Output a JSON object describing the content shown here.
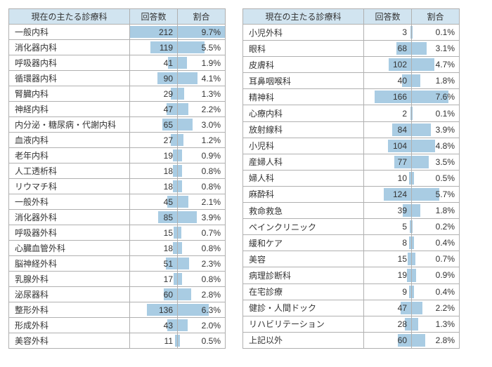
{
  "headers": {
    "dept": "現在の主たる診療科",
    "count": "回答数",
    "pct": "割合"
  },
  "rows_left": [
    {
      "dept": "一般内科",
      "count": 212,
      "pct": "9.7%"
    },
    {
      "dept": "消化器内科",
      "count": 119,
      "pct": "5.5%"
    },
    {
      "dept": "呼吸器内科",
      "count": 41,
      "pct": "1.9%"
    },
    {
      "dept": "循環器内科",
      "count": 90,
      "pct": "4.1%"
    },
    {
      "dept": "腎臓内科",
      "count": 29,
      "pct": "1.3%"
    },
    {
      "dept": "神経内科",
      "count": 47,
      "pct": "2.2%"
    },
    {
      "dept": "内分泌・糖尿病・代謝内科",
      "count": 65,
      "pct": "3.0%"
    },
    {
      "dept": "血液内科",
      "count": 27,
      "pct": "1.2%"
    },
    {
      "dept": "老年内科",
      "count": 19,
      "pct": "0.9%"
    },
    {
      "dept": "人工透析科",
      "count": 18,
      "pct": "0.8%"
    },
    {
      "dept": "リウマチ科",
      "count": 18,
      "pct": "0.8%"
    },
    {
      "dept": "一般外科",
      "count": 45,
      "pct": "2.1%"
    },
    {
      "dept": "消化器外科",
      "count": 85,
      "pct": "3.9%"
    },
    {
      "dept": "呼吸器外科",
      "count": 15,
      "pct": "0.7%"
    },
    {
      "dept": "心臓血管外科",
      "count": 18,
      "pct": "0.8%"
    },
    {
      "dept": "脳神経外科",
      "count": 51,
      "pct": "2.3%"
    },
    {
      "dept": "乳腺外科",
      "count": 17,
      "pct": "0.8%"
    },
    {
      "dept": "泌尿器科",
      "count": 60,
      "pct": "2.8%"
    },
    {
      "dept": "整形外科",
      "count": 136,
      "pct": "6.3%"
    },
    {
      "dept": "形成外科",
      "count": 43,
      "pct": "2.0%"
    },
    {
      "dept": "美容外科",
      "count": 11,
      "pct": "0.5%"
    }
  ],
  "rows_right": [
    {
      "dept": "小児外科",
      "count": 3,
      "pct": "0.1%"
    },
    {
      "dept": "眼科",
      "count": 68,
      "pct": "3.1%"
    },
    {
      "dept": "皮膚科",
      "count": 102,
      "pct": "4.7%"
    },
    {
      "dept": "耳鼻咽喉科",
      "count": 40,
      "pct": "1.8%"
    },
    {
      "dept": "精神科",
      "count": 166,
      "pct": "7.6%"
    },
    {
      "dept": "心療内科",
      "count": 2,
      "pct": "0.1%"
    },
    {
      "dept": "放射線科",
      "count": 84,
      "pct": "3.9%"
    },
    {
      "dept": "小児科",
      "count": 104,
      "pct": "4.8%"
    },
    {
      "dept": "産婦人科",
      "count": 77,
      "pct": "3.5%"
    },
    {
      "dept": "婦人科",
      "count": 10,
      "pct": "0.5%"
    },
    {
      "dept": "麻酔科",
      "count": 124,
      "pct": "5.7%"
    },
    {
      "dept": "救命救急",
      "count": 39,
      "pct": "1.8%"
    },
    {
      "dept": "ペインクリニック",
      "count": 5,
      "pct": "0.2%"
    },
    {
      "dept": "緩和ケア",
      "count": 8,
      "pct": "0.4%"
    },
    {
      "dept": "美容",
      "count": 15,
      "pct": "0.7%"
    },
    {
      "dept": "病理診断科",
      "count": 19,
      "pct": "0.9%"
    },
    {
      "dept": "在宅診療",
      "count": 9,
      "pct": "0.4%"
    },
    {
      "dept": "健診・人間ドック",
      "count": 47,
      "pct": "2.2%"
    },
    {
      "dept": "リハビリテーション",
      "count": 28,
      "pct": "1.3%"
    },
    {
      "dept": "上記以外",
      "count": 60,
      "pct": "2.8%"
    }
  ],
  "chart_data": {
    "type": "table",
    "title": "現在の主たる診療科",
    "columns": [
      "診療科",
      "回答数",
      "割合"
    ],
    "max_count": 212,
    "max_pct": 9.7,
    "rows": [
      [
        "一般内科",
        212,
        9.7
      ],
      [
        "消化器内科",
        119,
        5.5
      ],
      [
        "呼吸器内科",
        41,
        1.9
      ],
      [
        "循環器内科",
        90,
        4.1
      ],
      [
        "腎臓内科",
        29,
        1.3
      ],
      [
        "神経内科",
        47,
        2.2
      ],
      [
        "内分泌・糖尿病・代謝内科",
        65,
        3.0
      ],
      [
        "血液内科",
        27,
        1.2
      ],
      [
        "老年内科",
        19,
        0.9
      ],
      [
        "人工透析科",
        18,
        0.8
      ],
      [
        "リウマチ科",
        18,
        0.8
      ],
      [
        "一般外科",
        45,
        2.1
      ],
      [
        "消化器外科",
        85,
        3.9
      ],
      [
        "呼吸器外科",
        15,
        0.7
      ],
      [
        "心臓血管外科",
        18,
        0.8
      ],
      [
        "脳神経外科",
        51,
        2.3
      ],
      [
        "乳腺外科",
        17,
        0.8
      ],
      [
        "泌尿器科",
        60,
        2.8
      ],
      [
        "整形外科",
        136,
        6.3
      ],
      [
        "形成外科",
        43,
        2.0
      ],
      [
        "美容外科",
        11,
        0.5
      ],
      [
        "小児外科",
        3,
        0.1
      ],
      [
        "眼科",
        68,
        3.1
      ],
      [
        "皮膚科",
        102,
        4.7
      ],
      [
        "耳鼻咽喉科",
        40,
        1.8
      ],
      [
        "精神科",
        166,
        7.6
      ],
      [
        "心療内科",
        2,
        0.1
      ],
      [
        "放射線科",
        84,
        3.9
      ],
      [
        "小児科",
        104,
        4.8
      ],
      [
        "産婦人科",
        77,
        3.5
      ],
      [
        "婦人科",
        10,
        0.5
      ],
      [
        "麻酔科",
        124,
        5.7
      ],
      [
        "救命救急",
        39,
        1.8
      ],
      [
        "ペインクリニック",
        5,
        0.2
      ],
      [
        "緩和ケア",
        8,
        0.4
      ],
      [
        "美容",
        15,
        0.7
      ],
      [
        "病理診断科",
        19,
        0.9
      ],
      [
        "在宅診療",
        9,
        0.4
      ],
      [
        "健診・人間ドック",
        47,
        2.2
      ],
      [
        "リハビリテーション",
        28,
        1.3
      ],
      [
        "上記以外",
        60,
        2.8
      ]
    ]
  }
}
